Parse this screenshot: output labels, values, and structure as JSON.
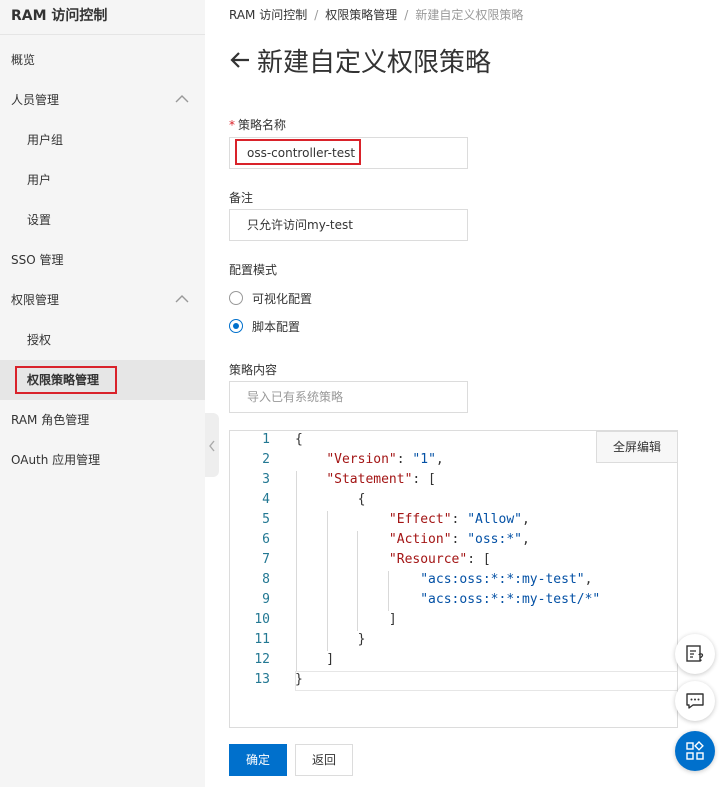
{
  "sidebar": {
    "title": "RAM 访问控制",
    "items": [
      {
        "label": "概览"
      },
      {
        "label": "人员管理"
      },
      {
        "label": "用户组"
      },
      {
        "label": "用户"
      },
      {
        "label": "设置"
      },
      {
        "label": "SSO 管理"
      },
      {
        "label": "权限管理"
      },
      {
        "label": "授权"
      },
      {
        "label": "权限策略管理"
      },
      {
        "label": "RAM 角色管理"
      },
      {
        "label": "OAuth 应用管理"
      }
    ]
  },
  "breadcrumb": [
    "RAM 访问控制",
    "权限策略管理",
    "新建自定义权限策略"
  ],
  "page_title": "新建自定义权限策略",
  "form": {
    "name_label": "策略名称",
    "name_required_mark": "*",
    "name_value": "oss-controller-test",
    "note_label": "备注",
    "note_value": "只允许访问my-test",
    "mode_label": "配置模式",
    "mode_options": [
      "可视化配置",
      "脚本配置"
    ],
    "mode_selected": "脚本配置",
    "content_label": "策略内容",
    "import_placeholder": "导入已有系统策略"
  },
  "editor": {
    "fullscreen_label": "全屏编辑",
    "line_numbers": [
      "1",
      "2",
      "3",
      "4",
      "5",
      "6",
      "7",
      "8",
      "9",
      "10",
      "11",
      "12",
      "13"
    ],
    "lines": [
      "{",
      "    \"Version\": \"1\",",
      "    \"Statement\": [",
      "        {",
      "            \"Effect\": \"Allow\",",
      "            \"Action\": \"oss:*\",",
      "            \"Resource\": [",
      "                \"acs:oss:*:*:my-test\",",
      "                \"acs:oss:*:*:my-test/*\"",
      "            ]",
      "        }",
      "    ]",
      "}"
    ]
  },
  "actions": {
    "confirm_label": "确定",
    "back_label": "返回"
  },
  "colors": {
    "primary": "#0070cc",
    "highlight": "#d9222a",
    "json_key": "#a31515",
    "json_string": "#0451a5",
    "line_number": "#237893"
  },
  "icons": [
    "chevron-up-icon",
    "chevron-left-icon",
    "back-arrow-icon",
    "feedback-edit-icon",
    "chat-icon",
    "apps-icon"
  ]
}
